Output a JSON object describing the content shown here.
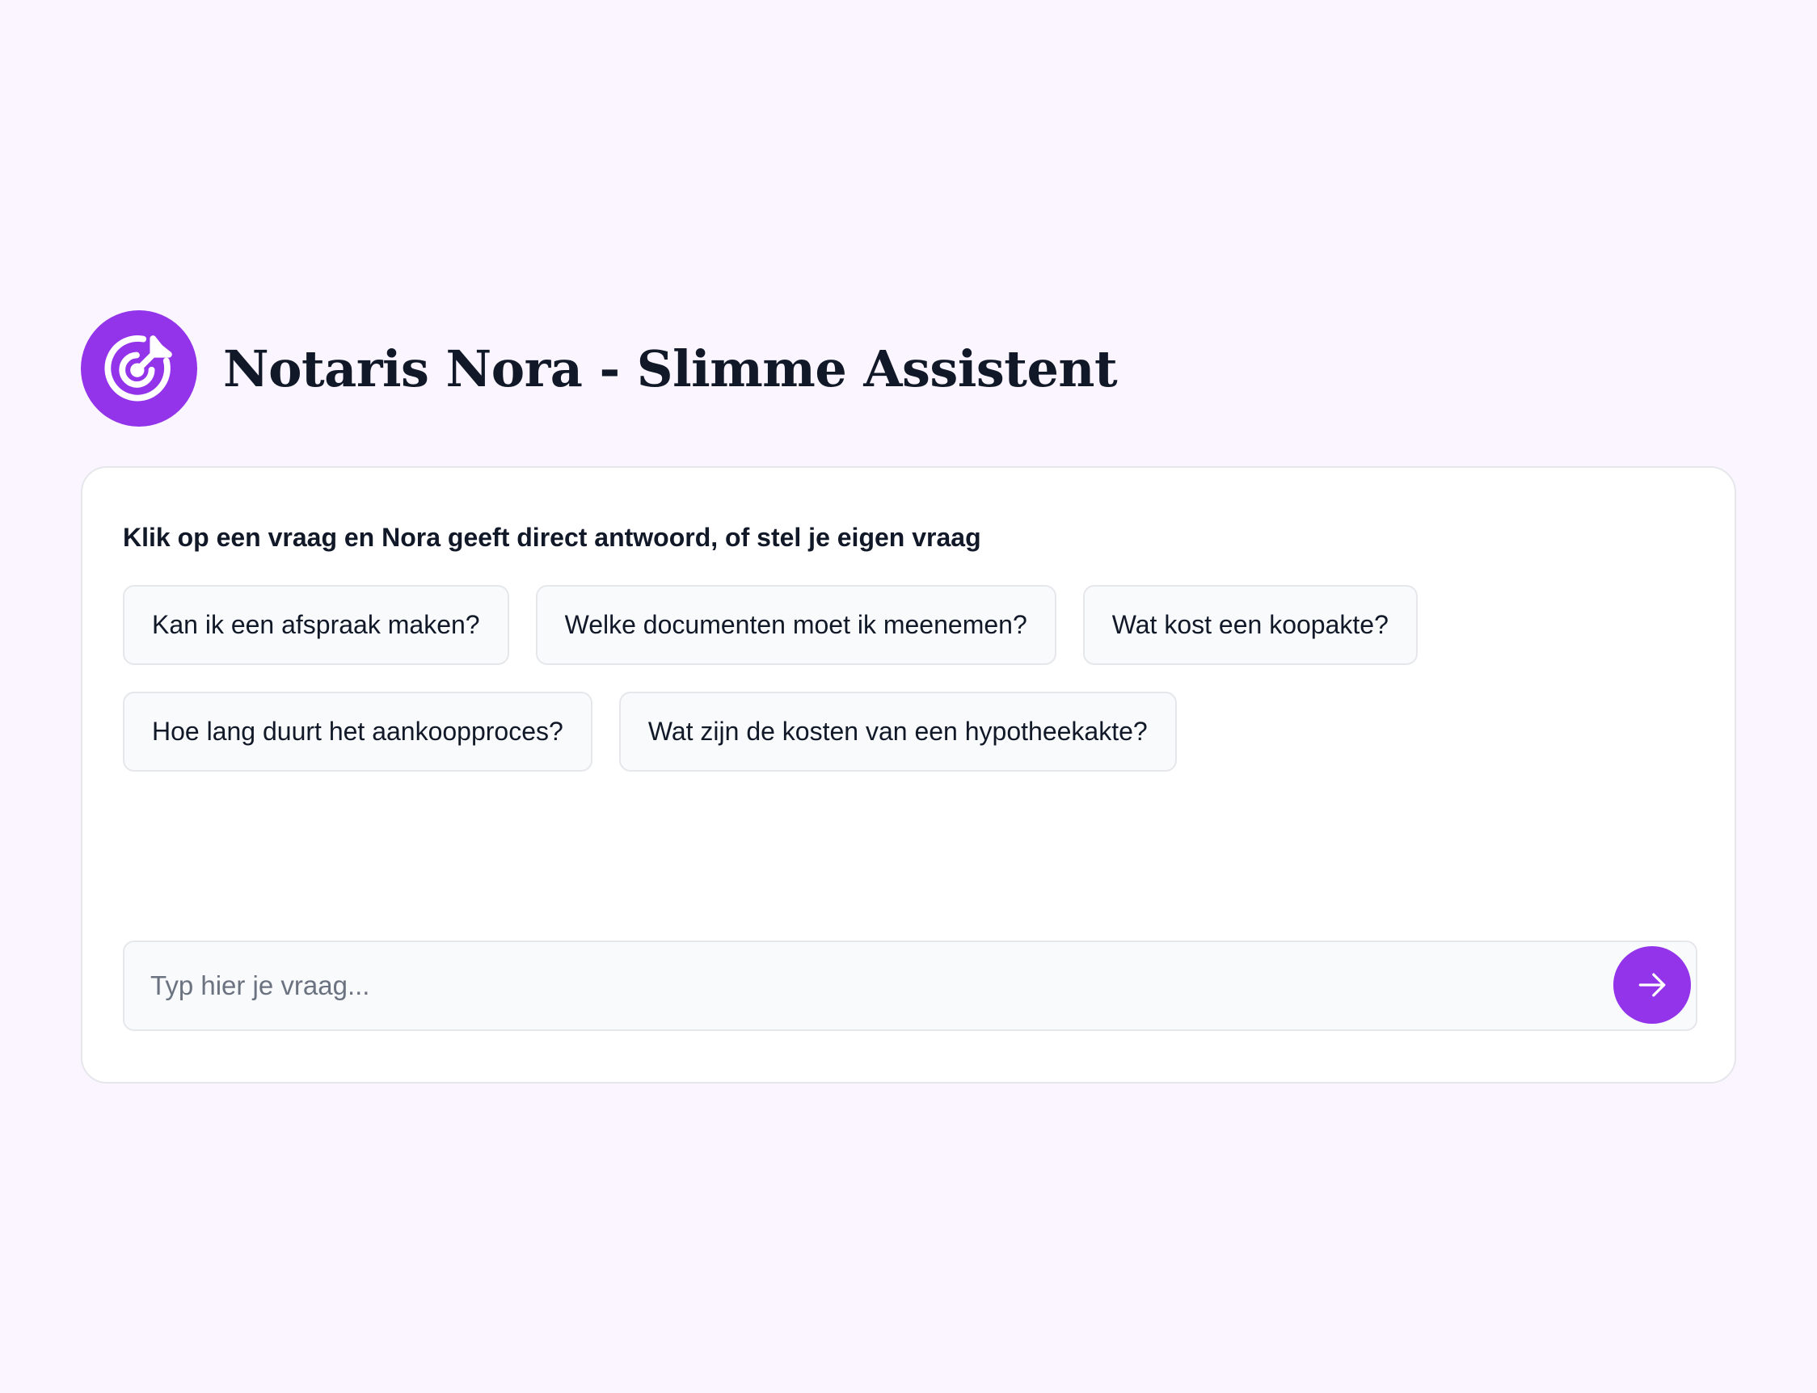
{
  "header": {
    "logo_icon": "target-arrow-icon",
    "title": "Notaris Nora - Slimme Assistent"
  },
  "chat": {
    "instruction": "Klik op een vraag en Nora geeft direct antwoord, of stel je eigen vraag",
    "suggestions": [
      "Kan ik een afspraak maken?",
      "Welke documenten moet ik meenemen?",
      "Wat kost een koopakte?",
      "Hoe lang duurt het aankoopproces?",
      "Wat zijn de kosten van een hypotheekakte?"
    ],
    "input": {
      "value": "",
      "placeholder": "Typ hier je vraag..."
    },
    "send_icon": "arrow-right-icon"
  },
  "colors": {
    "accent": "#9333ea",
    "background": "#faf5ff",
    "card": "#ffffff",
    "chip_background": "#f8fafc",
    "border": "#e5e7eb",
    "text": "#111827",
    "placeholder": "#6b7280"
  }
}
